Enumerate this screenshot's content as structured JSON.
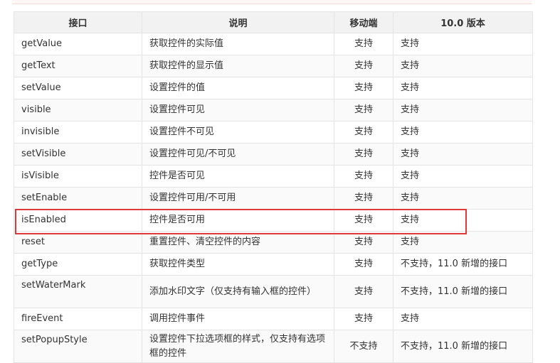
{
  "table": {
    "headers": [
      "接口",
      "说明",
      "移动端",
      "10.0 版本"
    ],
    "rows": [
      {
        "method": "getValue",
        "desc": "获取控件的实际值",
        "mobile": "支持",
        "v10": "支持"
      },
      {
        "method": "getText",
        "desc": "获取控件的显示值",
        "mobile": "支持",
        "v10": "支持"
      },
      {
        "method": "setValue",
        "desc": "设置控件的值",
        "mobile": "支持",
        "v10": "支持"
      },
      {
        "method": "visible",
        "desc": "设置控件可见",
        "mobile": "支持",
        "v10": "支持"
      },
      {
        "method": "invisible",
        "desc": "设置控件不可见",
        "mobile": "支持",
        "v10": "支持"
      },
      {
        "method": "setVisible",
        "desc": "设置控件可见/不可见",
        "mobile": "支持",
        "v10": "支持"
      },
      {
        "method": "isVisible",
        "desc": "控件是否可见",
        "mobile": "支持",
        "v10": "支持"
      },
      {
        "method": "setEnable",
        "desc": "设置控件可用/不可用",
        "mobile": "支持",
        "v10": "支持"
      },
      {
        "method": "isEnabled",
        "desc": "控件是否可用",
        "mobile": "支持",
        "v10": "支持"
      },
      {
        "method": "reset",
        "desc": "重置控件、清空控件的内容",
        "mobile": "支持",
        "v10": "支持"
      },
      {
        "method": "getType",
        "desc": "获取控件类型",
        "mobile": "支持",
        "v10": "不支持，11.0 新增的接口"
      },
      {
        "method": "setWaterMark",
        "desc": "添加水印文字（仅支持有输入框的控件）",
        "mobile": "支持",
        "v10": "不支持，11.0 新增的接口"
      },
      {
        "method": "fireEvent",
        "desc": "调用控件事件",
        "mobile": "支持",
        "v10": "支持"
      },
      {
        "method": "setPopupStyle",
        "desc": "设置控件下拉选项框的样式，仅支持有选项框的控件",
        "mobile": "不支持",
        "v10": "不支持，11.0 新增的接口"
      }
    ]
  },
  "highlight": {
    "row": "isEnabled",
    "color": "#e0393a"
  }
}
